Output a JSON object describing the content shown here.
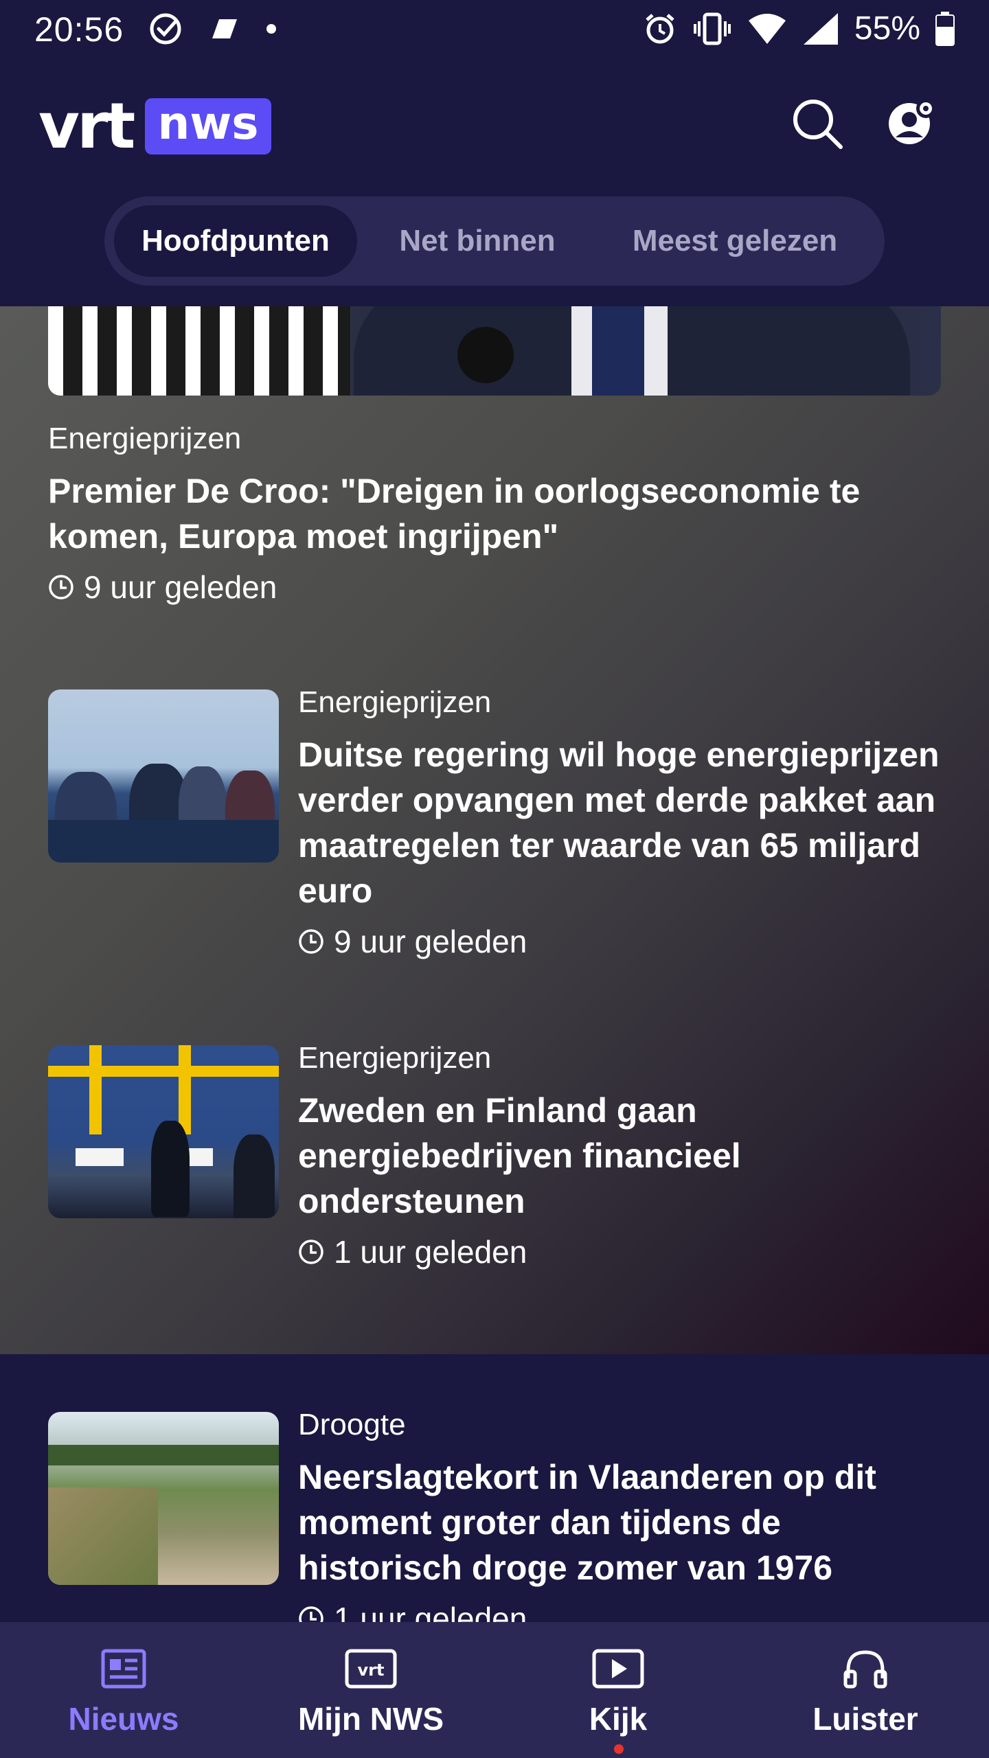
{
  "status_bar": {
    "time": "20:56",
    "battery": "55%"
  },
  "header": {
    "logo_left": "vrt",
    "logo_right": "nws",
    "tabs": [
      {
        "label": "Hoofdpunten",
        "active": true
      },
      {
        "label": "Net binnen",
        "active": false
      },
      {
        "label": "Meest gelezen",
        "active": false
      }
    ]
  },
  "stories": [
    {
      "kicker": "Energieprijzen",
      "title": "Premier De Croo: \"Dreigen in oorlogseconomie te komen, Europa moet ingrijpen\"",
      "time": "9 uur geleden"
    },
    {
      "kicker": "Energieprijzen",
      "title": "Duitse regering wil hoge energieprijzen verder opvangen met derde pakket aan maatregelen ter waarde van 65 miljard euro",
      "time": "9 uur geleden"
    },
    {
      "kicker": "Energieprijzen",
      "title": "Zweden en Finland gaan energiebedrijven financieel ondersteunen",
      "time": "1 uur geleden"
    },
    {
      "kicker": "Droogte",
      "title": "Neerslagtekort in Vlaanderen op dit moment groter dan tijdens de historisch droge zomer van 1976",
      "time": "1 uur geleden"
    }
  ],
  "bottom_nav": [
    {
      "label": "Nieuws",
      "icon": "newspaper-icon",
      "active": true
    },
    {
      "label": "Mijn NWS",
      "icon": "vrt-logo-icon",
      "active": false
    },
    {
      "label": "Kijk",
      "icon": "play-icon",
      "active": false
    },
    {
      "label": "Luister",
      "icon": "headphones-icon",
      "active": false
    }
  ],
  "colors": {
    "background": "#1a1740",
    "tab_bar": "#2c2856",
    "accent": "#5b4cf6",
    "active_nav": "#8c7cff",
    "notification_dot": "#e8342f"
  }
}
